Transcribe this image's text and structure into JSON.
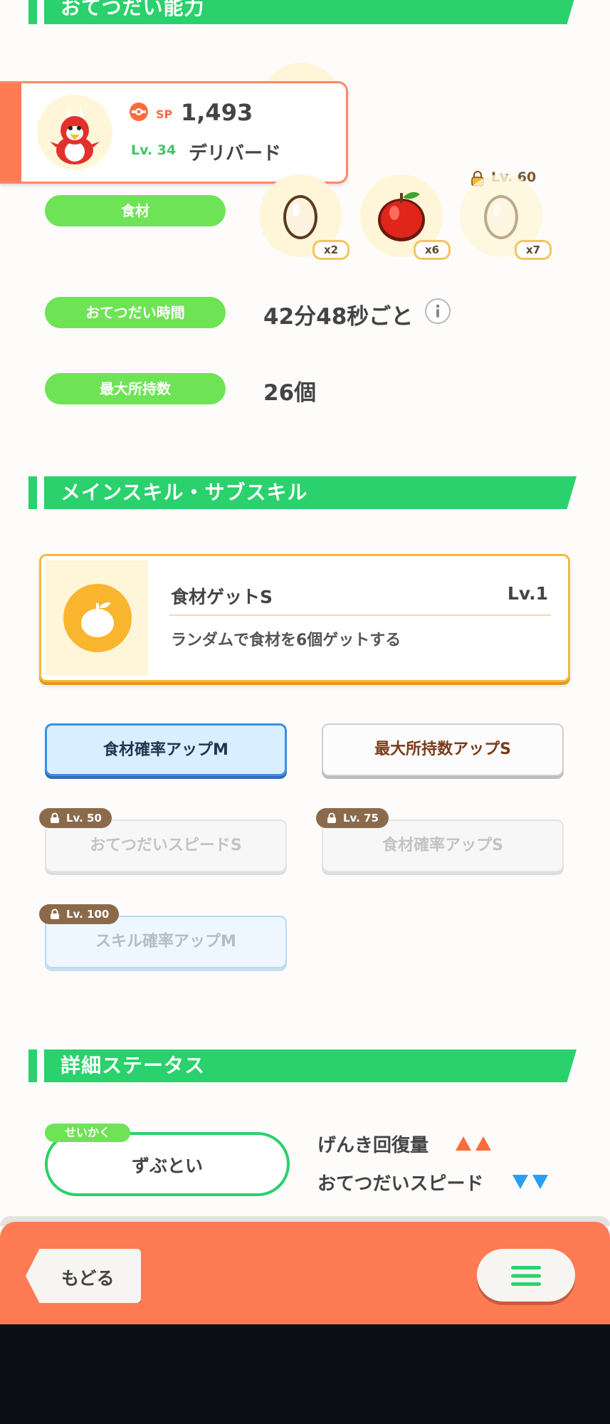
{
  "help_section": {
    "title": "おてつだい能力",
    "ingredients_label": "食材",
    "ingredients": [
      {
        "name": "egg-icon",
        "qty": "x2",
        "locked": false
      },
      {
        "name": "apple-icon",
        "qty": "x6",
        "locked": false
      },
      {
        "name": "egg-icon",
        "qty": "x7",
        "locked": true,
        "unlock_level": "Lv. 60"
      }
    ],
    "help_time_label": "おてつだい時間",
    "help_time_value": "42分48秒ごと",
    "max_carry_label": "最大所持数",
    "max_carry_value": "26個"
  },
  "pokemon_card": {
    "sp_label": "SP",
    "sp_value": "1,493",
    "level": "Lv. 34",
    "name": "デリバード"
  },
  "skills_section": {
    "title": "メインスキル・サブスキル",
    "main_skill": {
      "name": "食材ゲットS",
      "level": "Lv.1",
      "description": "ランダムで食材を6個ゲットする"
    },
    "sub_skills": [
      {
        "label": "食材確率アップM",
        "unlocked": true
      },
      {
        "label": "最大所持数アップS",
        "unlocked": true
      },
      {
        "label": "おてつだいスピードS",
        "unlock_level": "Lv. 50"
      },
      {
        "label": "食材確率アップS",
        "unlock_level": "Lv. 75"
      },
      {
        "label": "スキル確率アップM",
        "unlock_level": "Lv. 100"
      }
    ]
  },
  "detail_section": {
    "title": "詳細ステータス",
    "nature_tag": "せいかく",
    "nature_value": "ずぶとい",
    "up_stat": "げんき回復量",
    "down_stat": "おてつだいスピード"
  },
  "bottom_bar": {
    "back_label": "もどる"
  },
  "colors": {
    "accent_green": "#2bd16c",
    "pill_green": "#6fe356",
    "bottom_orange": "#ff7b54",
    "skill_gold": "#f5b93a",
    "up_arrow": "#ff6a3d",
    "down_arrow": "#2a9df4"
  }
}
